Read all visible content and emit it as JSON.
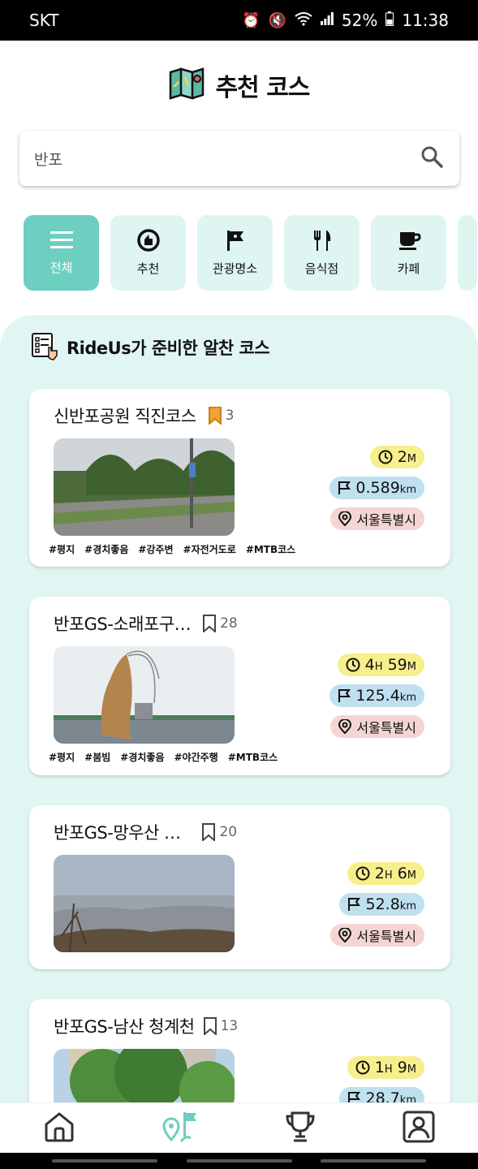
{
  "status": {
    "carrier": "SKT",
    "battery": "52%",
    "time": "11:38"
  },
  "header": {
    "title": "추천 코스",
    "icon": "map-icon"
  },
  "search": {
    "value": "반포",
    "icon": "search-icon"
  },
  "categories": [
    {
      "label": "전체",
      "icon": "menu-icon",
      "active": true
    },
    {
      "label": "추천",
      "icon": "thumbs-up-icon",
      "active": false
    },
    {
      "label": "관광명소",
      "icon": "flag-icon",
      "active": false
    },
    {
      "label": "음식점",
      "icon": "utensils-icon",
      "active": false
    },
    {
      "label": "카페",
      "icon": "coffee-icon",
      "active": false
    }
  ],
  "section": {
    "title": "RideUs가 준비한 알찬 코스"
  },
  "courses": [
    {
      "title": "신반포공원 직진코스",
      "bookmarks": "3",
      "bookmarked": true,
      "time": {
        "h": "",
        "m": "2"
      },
      "distance": "0.589",
      "region": "서울특별시",
      "tags": [
        "#평지",
        "#경치좋음",
        "#강주변",
        "#자전거도로",
        "#MTB코스"
      ]
    },
    {
      "title": "반포GS-소래포구…",
      "bookmarks": "28",
      "bookmarked": false,
      "time": {
        "h": "4",
        "m": "59"
      },
      "distance": "125.4",
      "region": "서울특별시",
      "tags": [
        "#평지",
        "#붐빔",
        "#경치좋음",
        "#야간주행",
        "#MTB코스"
      ]
    },
    {
      "title": "반포GS-망우산 …",
      "bookmarks": "20",
      "bookmarked": false,
      "time": {
        "h": "2",
        "m": "6"
      },
      "distance": "52.8",
      "region": "서울특별시",
      "tags": []
    },
    {
      "title": "반포GS-남산 청계천",
      "bookmarks": "13",
      "bookmarked": false,
      "time": {
        "h": "1",
        "m": "9"
      },
      "distance": "28.7",
      "region": "",
      "tags": []
    }
  ],
  "units": {
    "hour": "H",
    "minute": "M",
    "km": "km"
  },
  "nav": [
    "home-icon",
    "course-map-icon",
    "trophy-icon",
    "profile-icon"
  ]
}
